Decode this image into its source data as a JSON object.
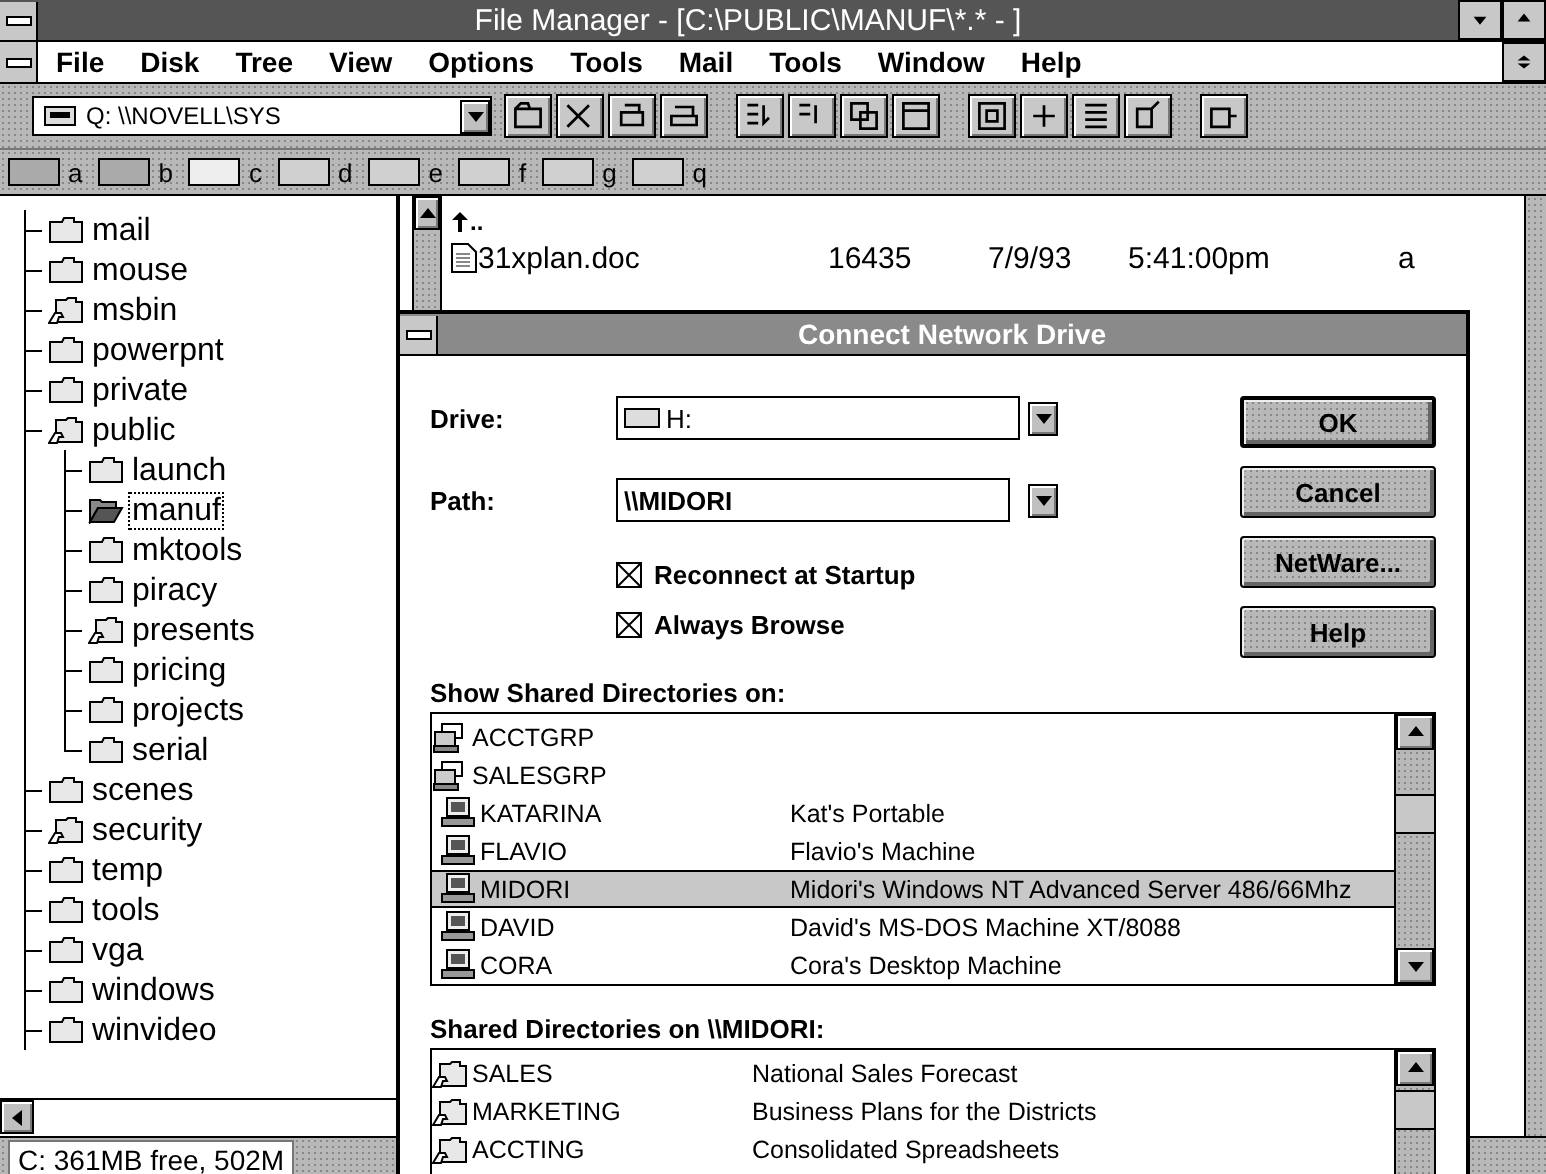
{
  "window": {
    "title": "File Manager - [C:\\PUBLIC\\MANUF\\*.* - ]"
  },
  "menu": [
    {
      "label": "File"
    },
    {
      "label": "Disk"
    },
    {
      "label": "Tree"
    },
    {
      "label": "View"
    },
    {
      "label": "Options"
    },
    {
      "label": "Tools"
    },
    {
      "label": "Mail"
    },
    {
      "label": "Tools"
    },
    {
      "label": "Window"
    },
    {
      "label": "Help"
    }
  ],
  "toolbar": {
    "drive_combo": "Q: \\\\NOVELL\\SYS"
  },
  "drives": [
    {
      "letter": "a",
      "kind": "floppy"
    },
    {
      "letter": "b",
      "kind": "floppy"
    },
    {
      "letter": "c",
      "kind": "hard"
    },
    {
      "letter": "d",
      "kind": "network"
    },
    {
      "letter": "e",
      "kind": "network"
    },
    {
      "letter": "f",
      "kind": "network"
    },
    {
      "letter": "g",
      "kind": "network"
    },
    {
      "letter": "q",
      "kind": "network"
    }
  ],
  "tree": [
    {
      "label": "mail",
      "kind": "folder",
      "selected": false
    },
    {
      "label": "mouse",
      "kind": "folder",
      "selected": false
    },
    {
      "label": "msbin",
      "kind": "shared",
      "selected": false
    },
    {
      "label": "powerpnt",
      "kind": "folder",
      "selected": false
    },
    {
      "label": "private",
      "kind": "folder",
      "selected": false
    },
    {
      "label": "public",
      "kind": "shared",
      "selected": false,
      "children": [
        {
          "label": "launch",
          "kind": "folder",
          "selected": false
        },
        {
          "label": "manuf",
          "kind": "open",
          "selected": true
        },
        {
          "label": "mktools",
          "kind": "folder",
          "selected": false
        },
        {
          "label": "piracy",
          "kind": "folder",
          "selected": false
        },
        {
          "label": "presents",
          "kind": "shared",
          "selected": false
        },
        {
          "label": "pricing",
          "kind": "folder",
          "selected": false
        },
        {
          "label": "projects",
          "kind": "folder",
          "selected": false
        },
        {
          "label": "serial",
          "kind": "folder",
          "selected": false
        }
      ]
    },
    {
      "label": "scenes",
      "kind": "folder",
      "selected": false
    },
    {
      "label": "security",
      "kind": "shared",
      "selected": false
    },
    {
      "label": "temp",
      "kind": "folder",
      "selected": false
    },
    {
      "label": "tools",
      "kind": "folder",
      "selected": false
    },
    {
      "label": "vga",
      "kind": "folder",
      "selected": false
    },
    {
      "label": "windows",
      "kind": "folder",
      "selected": false
    },
    {
      "label": "winvideo",
      "kind": "folder",
      "selected": false
    }
  ],
  "files": [
    {
      "name": "..",
      "kind": "parent"
    },
    {
      "name": "31xplan.doc",
      "kind": "document",
      "size": "16435",
      "date": "7/9/93",
      "time": "5:41:00pm",
      "attributes": "a"
    }
  ],
  "status_bar": "C: 361MB free, 502M",
  "dialog": {
    "title": "Connect Network Drive",
    "drive": {
      "label": "Drive:",
      "value": "H:"
    },
    "path": {
      "label": "Path:",
      "value": "\\\\MIDORI"
    },
    "options": [
      {
        "label": "Reconnect at Startup",
        "checked": true
      },
      {
        "label": "Always Browse",
        "checked": true
      }
    ],
    "buttons": [
      {
        "label": "OK",
        "default": true
      },
      {
        "label": "Cancel",
        "default": false
      },
      {
        "label": "NetWare...",
        "default": false
      },
      {
        "label": "Help",
        "default": false
      }
    ],
    "computers": {
      "label": "Show Shared Directories on:",
      "rows": [
        {
          "name": "ACCTGRP",
          "kind": "workgroup",
          "selected": false
        },
        {
          "name": "SALESGRP",
          "kind": "workgroup",
          "selected": false
        },
        {
          "name": "KATARINA",
          "kind": "computer",
          "comment": "Kat's Portable",
          "selected": false
        },
        {
          "name": "FLAVIO",
          "kind": "computer",
          "comment": "Flavio's Machine",
          "selected": false
        },
        {
          "name": "MIDORI",
          "kind": "computer",
          "comment": "Midori's Windows NT Advanced Server 486/66Mhz",
          "selected": true
        },
        {
          "name": "DAVID",
          "kind": "computer",
          "comment": "David's MS-DOS Machine XT/8088",
          "selected": false
        },
        {
          "name": "CORA",
          "kind": "computer",
          "comment": "Cora's Desktop Machine",
          "selected": false
        }
      ]
    },
    "shares": {
      "label": "Shared Directories on \\\\MIDORI:",
      "rows": [
        {
          "name": "SALES",
          "comment": "National Sales Forecast"
        },
        {
          "name": "MARKETING",
          "comment": "Business Plans for the Districts"
        },
        {
          "name": "ACCTING",
          "comment": "Consolidated Spreadsheets"
        }
      ]
    }
  }
}
